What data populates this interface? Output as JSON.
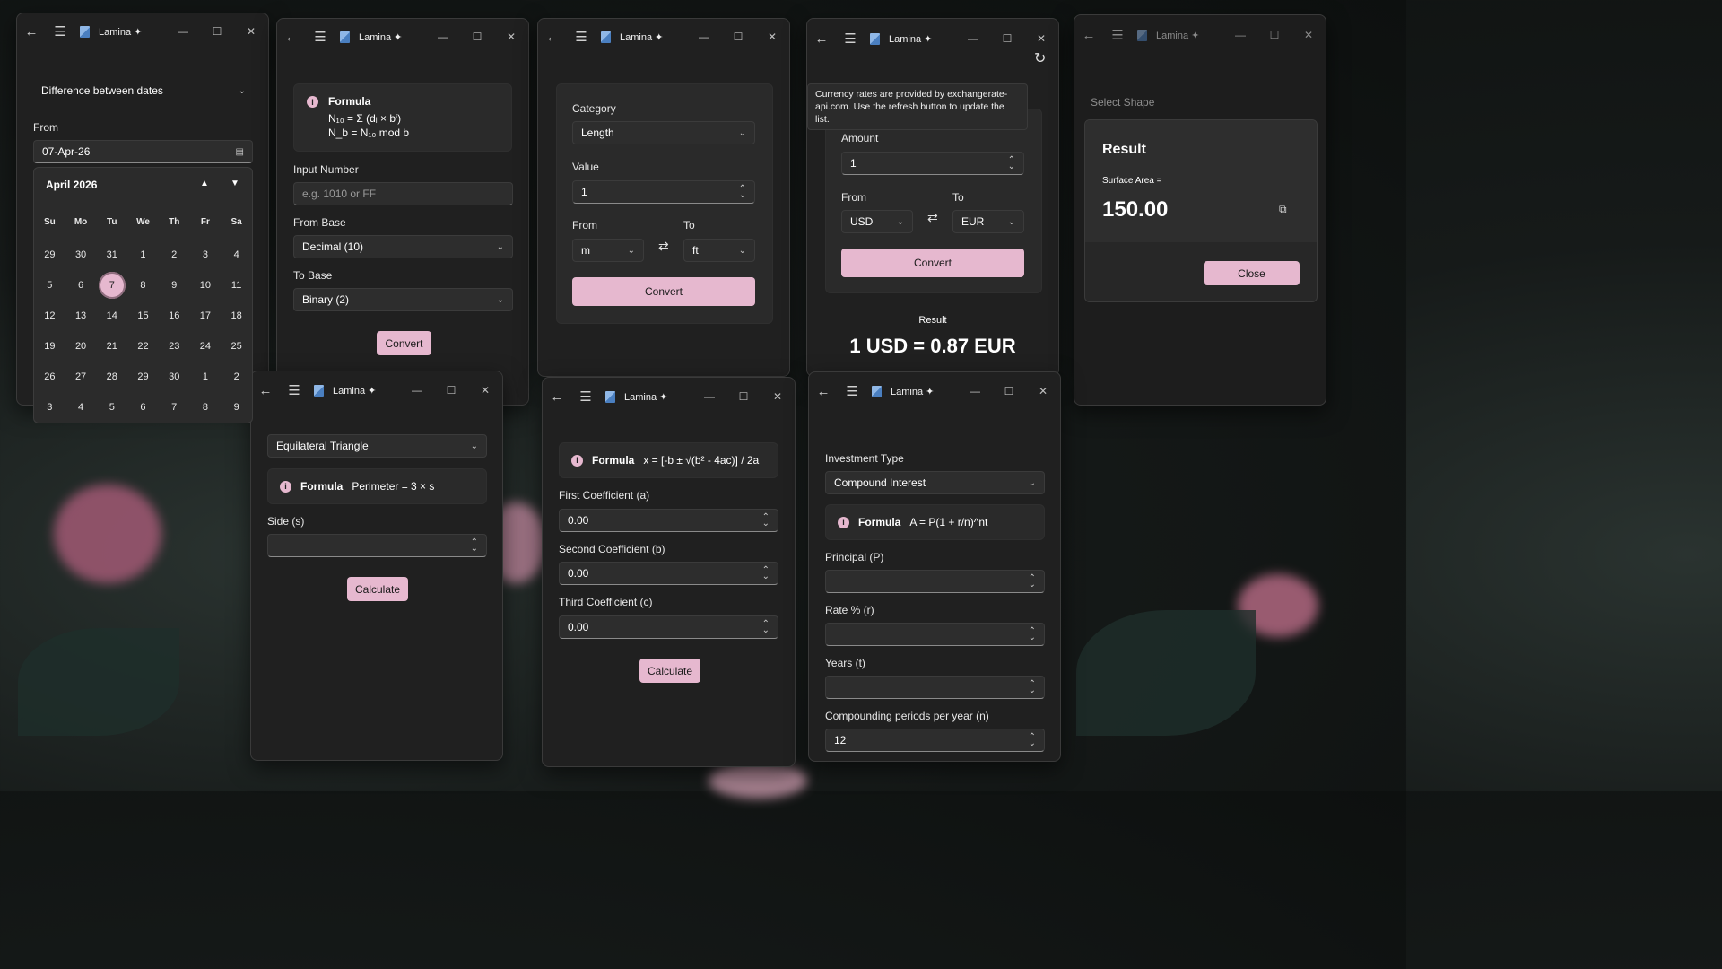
{
  "app": {
    "title": "Lamina ✦"
  },
  "date_window": {
    "mode": "Difference between dates",
    "from_label": "From",
    "from_value": "07-Apr-26",
    "calendar": {
      "month": "April 2026",
      "weekdays": [
        "Su",
        "Mo",
        "Tu",
        "We",
        "Th",
        "Fr",
        "Sa"
      ],
      "days": [
        "29",
        "30",
        "31",
        "1",
        "2",
        "3",
        "4",
        "5",
        "6",
        "7",
        "8",
        "9",
        "10",
        "11",
        "12",
        "13",
        "14",
        "15",
        "16",
        "17",
        "18",
        "19",
        "20",
        "21",
        "22",
        "23",
        "24",
        "25",
        "26",
        "27",
        "28",
        "29",
        "30",
        "1",
        "2",
        "3",
        "4",
        "5",
        "6",
        "7",
        "8",
        "9"
      ],
      "selected": "7"
    }
  },
  "base_window": {
    "formula_title": "Formula",
    "formula_line1": "N₁₀ = Σ (dᵢ × bⁱ)",
    "formula_line2": "N_b = N₁₀ mod b",
    "input_label": "Input Number",
    "input_placeholder": "e.g. 1010 or FF",
    "from_label": "From Base",
    "from_value": "Decimal (10)",
    "to_label": "To Base",
    "to_value": "Binary (2)",
    "convert": "Convert"
  },
  "unit_window": {
    "category_label": "Category",
    "category_value": "Length",
    "value_label": "Value",
    "value": "1",
    "from_label": "From",
    "from_value": "m",
    "to_label": "To",
    "to_value": "ft",
    "convert": "Convert"
  },
  "currency_window": {
    "tooltip": "Currency rates are provided by exchangerate-api.com. Use the refresh button to update the list.",
    "amount_label": "Amount",
    "amount_value": "1",
    "from_label": "From",
    "from_value": "USD",
    "to_label": "To",
    "to_value": "EUR",
    "convert": "Convert",
    "result_label": "Result",
    "result_value": "1 USD = 0.87 EUR"
  },
  "shape_result_window": {
    "select_label": "Select Shape",
    "dialog_title": "Result",
    "surface_label": "Surface Area =",
    "surface_value": "150.00",
    "close": "Close"
  },
  "triangle_window": {
    "shape_value": "Equilateral Triangle",
    "formula_title": "Formula",
    "formula": "Perimeter = 3 × s",
    "side_label": "Side (s)",
    "calculate": "Calculate"
  },
  "quadratic_window": {
    "formula_title": "Formula",
    "formula": "x = [-b ± √(b² - 4ac)] / 2a",
    "a_label": "First Coefficient (a)",
    "a_value": "0.00",
    "b_label": "Second Coefficient (b)",
    "b_value": "0.00",
    "c_label": "Third Coefficient (c)",
    "c_value": "0.00",
    "calculate": "Calculate"
  },
  "investment_window": {
    "type_label": "Investment Type",
    "type_value": "Compound Interest",
    "formula_title": "Formula",
    "formula": "A = P(1 + r/n)^nt",
    "principal_label": "Principal (P)",
    "rate_label": "Rate % (r)",
    "years_label": "Years (t)",
    "periods_label": "Compounding periods per year (n)",
    "periods_value": "12"
  },
  "colors": {
    "accent": "#e6b8cf",
    "window_bg": "#202020",
    "field_bg": "#2d2d2d"
  }
}
